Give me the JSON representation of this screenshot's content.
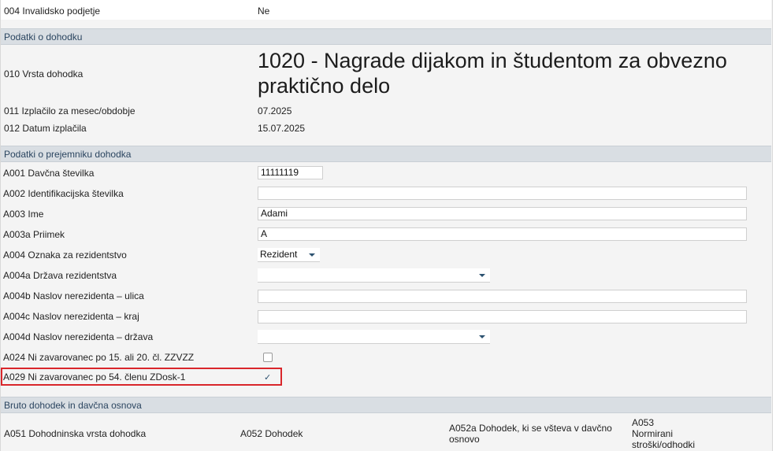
{
  "top": {
    "row004": {
      "label": "004 Invalidsko podjetje",
      "value": "Ne"
    }
  },
  "income": {
    "section_title": "Podatki o dohodku",
    "row010": {
      "label": "010 Vrsta dohodka",
      "value_line1": "1020 - Nagrade dijakom in študentom za obvezno",
      "value_line2": "praktično delo"
    },
    "row011": {
      "label": "011 Izplačilo za mesec/obdobje",
      "value": "07.2025"
    },
    "row012": {
      "label": "012 Datum izplačila",
      "value": "15.07.2025"
    }
  },
  "recipient": {
    "section_title": "Podatki o prejemniku dohodka",
    "A001": {
      "label": "A001 Davčna številka",
      "value": "11111119"
    },
    "A002": {
      "label": "A002 Identifikacijska številka",
      "value": ""
    },
    "A003": {
      "label": "A003 Ime",
      "value": "Adami"
    },
    "A003a": {
      "label": "A003a Priimek",
      "value": "A"
    },
    "A004": {
      "label": "A004 Oznaka za rezidentstvo",
      "value": "Rezident"
    },
    "A004a": {
      "label": "A004a Država rezidentstva",
      "value": ""
    },
    "A004b": {
      "label": "A004b Naslov nerezidenta – ulica",
      "value": ""
    },
    "A004c": {
      "label": "A004c Naslov nerezidenta – kraj",
      "value": ""
    },
    "A004d": {
      "label": "A004d Naslov nerezidenta – država",
      "value": ""
    },
    "A024": {
      "label": "A024 Ni zavarovanec po 15. ali 20. čl. ZZVZZ",
      "checked": false
    },
    "A029": {
      "label": "A029 Ni zavarovanec po 54. členu ZDosk-1",
      "checked": true,
      "check_glyph": "✓"
    }
  },
  "gross": {
    "section_title": "Bruto dohodek in davčna osnova",
    "col_A051": "A051 Dohodninska vrsta dohodka",
    "col_A052": "A052 Dohodek",
    "col_A052a_line1": "A052a Dohodek, ki se všteva v davčno",
    "col_A052a_line2": "osnovo",
    "col_A053_line1": "A053",
    "col_A053_line2": "Normirani",
    "col_A053_line3": "stroški/odhodki"
  },
  "colors": {
    "highlight": "#d9262b",
    "section_bg": "#d9dee3",
    "section_text": "#2b4560"
  }
}
